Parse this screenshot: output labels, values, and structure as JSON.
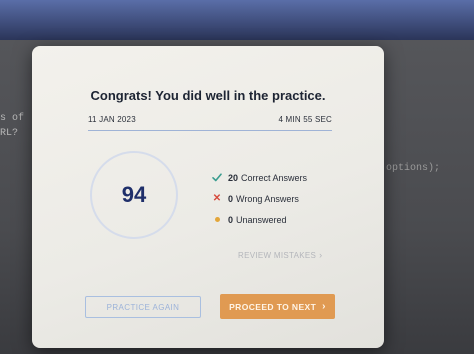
{
  "background": {
    "left_text_1": "s of",
    "left_text_2": "RL?",
    "code_text": "options);"
  },
  "modal": {
    "title": "Congrats! You did well in the practice.",
    "date": "11 JAN 2023",
    "duration": "4 MIN 55 SEC",
    "score": "94",
    "stats": {
      "correct": {
        "count": "20",
        "label": "Correct Answers",
        "icon": "check-icon",
        "color": "#3a9d8f"
      },
      "wrong": {
        "count": "0",
        "label": "Wrong Answers",
        "icon": "x-icon",
        "color": "#d64a3c"
      },
      "unanswered": {
        "count": "0",
        "label": "Unanswered",
        "icon": "dot-icon",
        "color": "#e3a63a"
      }
    },
    "review_label": "REVIEW MISTAKES",
    "practice_again_label": "PRACTICE AGAIN",
    "proceed_label": "PROCEED TO NEXT"
  },
  "colors": {
    "accent_orange": "#e09a52",
    "score_blue": "#1f2f6a",
    "outline_blue": "#a9bfe0"
  }
}
